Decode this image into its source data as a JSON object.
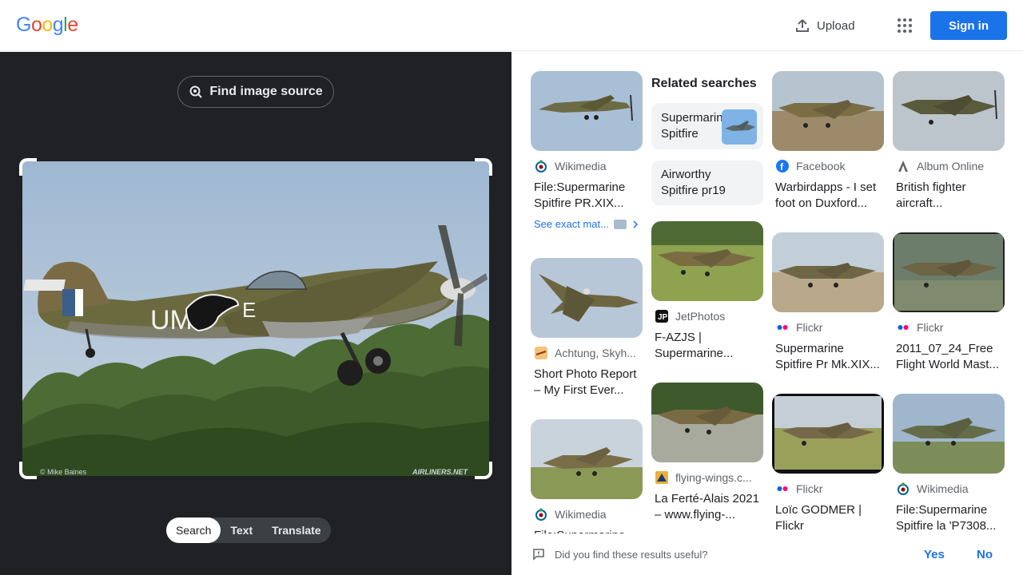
{
  "header": {
    "logo": [
      "G",
      "o",
      "o",
      "g",
      "l",
      "e"
    ],
    "logo_colors": [
      "#4285F4",
      "#EA4335",
      "#FBBC05",
      "#4285F4",
      "#34A853",
      "#EA4335"
    ],
    "upload_label": "Upload",
    "signin_label": "Sign in"
  },
  "left": {
    "find_source_label": "Find image source",
    "tabs": [
      "Search",
      "Text",
      "Translate"
    ],
    "active_tab": "Search",
    "photo_markings": "UM",
    "photo_letter": "E",
    "photo_credit_left": "© Mike Baines",
    "photo_credit_right": "AIRLINERS.NET"
  },
  "results": {
    "related_title": "Related searches",
    "chips": [
      "Supermarine Spitfire",
      "Airworthy Spitfire pr19"
    ],
    "see_exact": "See exact mat...",
    "cards": [
      {
        "source": "Wikimedia",
        "title": "File:Supermarine Spitfire PR.XIX..."
      },
      {
        "source": "Facebook",
        "title": "Warbirdapps - I set foot on Duxford..."
      },
      {
        "source": "Album Online",
        "title": "British fighter aircraft..."
      },
      {
        "source": "Achtung, Skyh...",
        "title": "Short Photo Report – My First Ever..."
      },
      {
        "source": "JetPhotos",
        "title": "F-AZJS | Supermarine..."
      },
      {
        "source": "Flickr",
        "title": "Supermarine Spitfire Pr Mk.XIX..."
      },
      {
        "source": "Flickr",
        "title": "2011_07_24_Free Flight World Mast..."
      },
      {
        "source": "Wikimedia",
        "title": "File:Supermarine Spitfire..."
      },
      {
        "source": "flying-wings.c...",
        "title": "La Ferté-Alais 2021 – www.flying-..."
      },
      {
        "source": "Flickr",
        "title": "Loïc GODMER | Flickr"
      },
      {
        "source": "Wikimedia",
        "title": "File:Supermarine Spitfire la 'P7308..."
      }
    ]
  },
  "feedback": {
    "question": "Did you find these results useful?",
    "yes": "Yes",
    "no": "No"
  }
}
